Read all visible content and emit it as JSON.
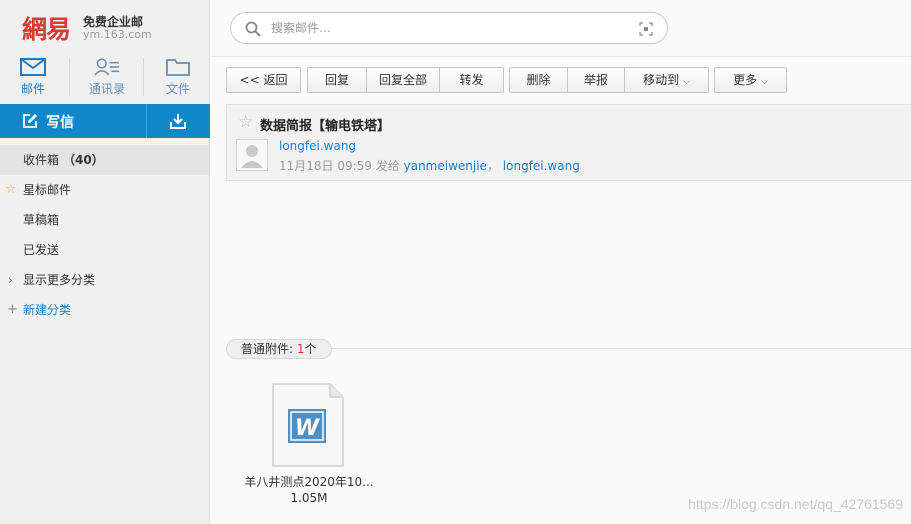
{
  "logo": {
    "mark": "網易",
    "slogan": "免费企业邮",
    "domain": "ym.163.com"
  },
  "nav": [
    {
      "label": "邮件",
      "icon": "mail-icon",
      "active": true
    },
    {
      "label": "通讯录",
      "icon": "contacts-icon",
      "active": false
    },
    {
      "label": "文件",
      "icon": "folder-icon",
      "active": false
    }
  ],
  "compose": {
    "label": "写信",
    "icon": "compose-icon",
    "receive_icon": "download-icon",
    "color": "#0f87c9"
  },
  "folders": {
    "inbox": {
      "label": "收件箱",
      "count": "（40）"
    },
    "starred": {
      "label": "星标邮件"
    },
    "drafts": {
      "label": "草稿箱"
    },
    "sent": {
      "label": "已发送"
    },
    "more": {
      "label": "显示更多分类"
    },
    "new_category": {
      "label": "新建分类"
    }
  },
  "search": {
    "placeholder": "搜索邮件…",
    "icon": "search-icon",
    "scan_icon": "scan-icon"
  },
  "toolbar": {
    "back": "<< 返回",
    "reply": "回复",
    "reply_all": "回复全部",
    "forward": "转发",
    "delete": "删除",
    "report": "举报",
    "move_to": "移动到",
    "more": "更多"
  },
  "mail": {
    "subject": "数据简报【输电铁塔】",
    "sender": "longfei.wang",
    "date": "11月18日 09:59",
    "sent_to_label": "发给",
    "recipients": [
      "yanmeiwenjie",
      "longfei.wang"
    ],
    "separator": "，"
  },
  "attachments": {
    "label_prefix": "普通附件:",
    "count": "1",
    "count_suffix": "个",
    "items": [
      {
        "name": "羊八井测点2020年10...",
        "size": "1.05M",
        "icon": "word-doc-icon"
      }
    ]
  },
  "watermark": "https://blog.csdn.net/qq_42761569",
  "colors": {
    "brand_red": "#d93a33",
    "link_blue": "#1f7cc4",
    "count_red": "#e33333"
  }
}
